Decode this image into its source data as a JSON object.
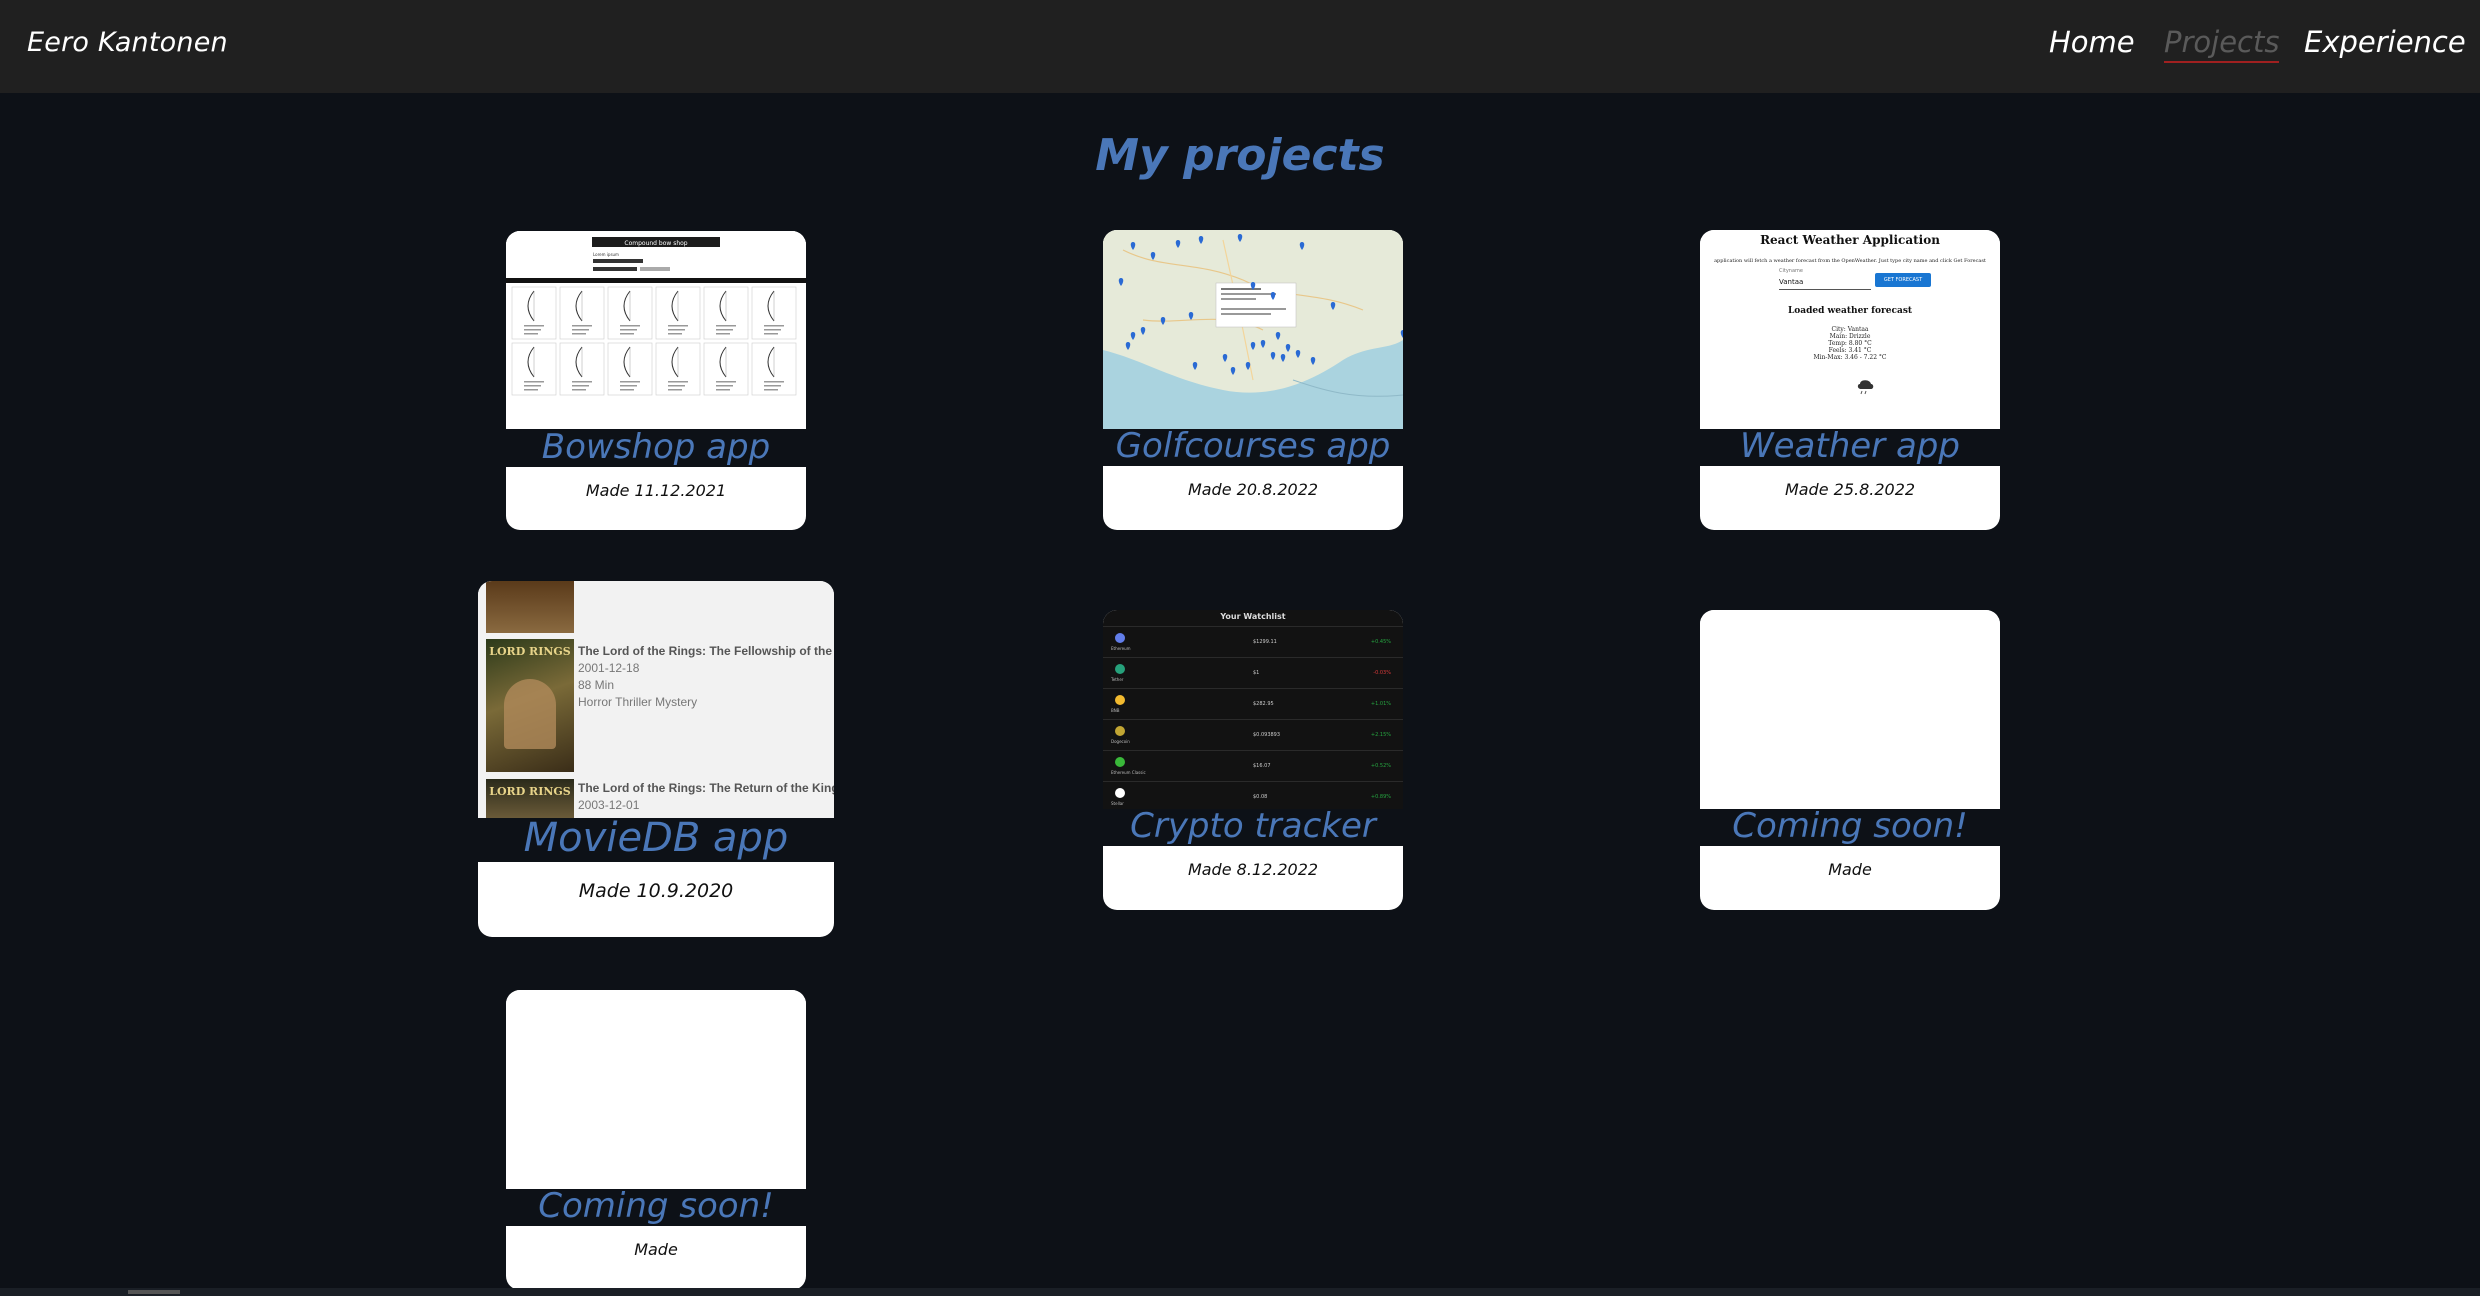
{
  "header": {
    "brand": "Eero Kantonen",
    "nav": [
      {
        "label": "Home"
      },
      {
        "label": "Projects",
        "active": true
      },
      {
        "label": "Experience"
      }
    ]
  },
  "page": {
    "title": "My projects"
  },
  "projects": [
    {
      "title": "Bowshop app",
      "date": "Made 11.12.2021",
      "thumb": "bowshop-screenshot"
    },
    {
      "title": "Golfcourses app",
      "date": "Made 20.8.2022",
      "thumb": "golf-map-screenshot"
    },
    {
      "title": "Weather app",
      "date": "Made 25.8.2022",
      "thumb": "weather-screenshot"
    },
    {
      "title": "MovieDB app",
      "date": "Made 10.9.2020",
      "thumb": "moviedb-screenshot"
    },
    {
      "title": "Crypto tracker",
      "date": "Made 8.12.2022",
      "thumb": "crypto-screenshot"
    },
    {
      "title": "Coming soon!",
      "date": "Made",
      "thumb": "blank"
    },
    {
      "title": "Coming soon!",
      "date": "Made",
      "thumb": "blank"
    }
  ],
  "thumbs": {
    "bowshop": {
      "header": "Compound bow shop",
      "sub": "Lorem ipsum"
    },
    "weather": {
      "title": "React Weather Application",
      "desc": "application will fetch a weather forecast from the OpenWeather. Just type city name and click Get Forecast",
      "input_label": "Cityname",
      "input_value": "Vantaa",
      "button": "GET FORECAST",
      "loaded": "Loaded weather forecast",
      "lines": [
        "City: Vantaa",
        "Main: Drizzle",
        "Temp: 8.80 °C",
        "Feels: 3.41 °C",
        "Min-Max: 3.46 - 7.22 °C"
      ]
    },
    "moviedb": {
      "movies": [
        {
          "title": "The Lord of the Rings: The Fellowship of the Ring",
          "date": "2001-12-18",
          "runtime": "88 Min",
          "genres": "Horror Thriller Mystery"
        },
        {
          "title": "The Lord of the Rings: The Return of the King",
          "date": "2003-12-01"
        }
      ],
      "poster_text": "LORD RINGS"
    },
    "crypto": {
      "header": "Your Watchlist",
      "rows": [
        {
          "name": "Ethereum",
          "price": "$1299.11",
          "change": "+0.45%",
          "color": "#26a641",
          "icon_color": "#627eea"
        },
        {
          "name": "Tether",
          "price": "$1",
          "change": "-0.03%",
          "color": "#d83a3a",
          "icon_color": "#26a17b"
        },
        {
          "name": "BNB",
          "price": "$282.95",
          "change": "+1.01%",
          "color": "#26a641",
          "icon_color": "#f3ba2f"
        },
        {
          "name": "Dogecoin",
          "price": "$0.093893",
          "change": "+2.15%",
          "color": "#26a641",
          "icon_color": "#c2a633"
        },
        {
          "name": "Ethereum Classic",
          "price": "$16.07",
          "change": "+0.52%",
          "color": "#26a641",
          "icon_color": "#3ab83a"
        },
        {
          "name": "Stellar",
          "price": "$0.08",
          "change": "+0.89%",
          "color": "#26a641",
          "icon_color": "#ffffff"
        }
      ]
    }
  },
  "colors": {
    "background": "#0d1117",
    "navbar": "#202020",
    "accent": "#4a77b8",
    "active_nav": "#5a5a5a",
    "active_underline": "#a02020"
  }
}
